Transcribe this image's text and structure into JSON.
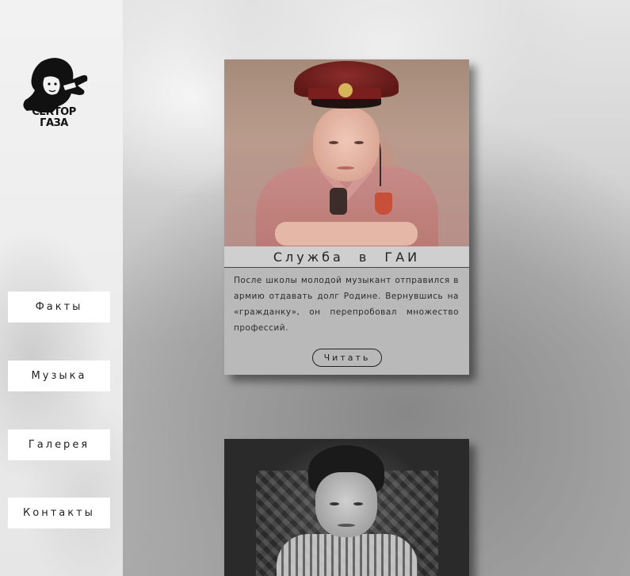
{
  "logo": {
    "text": "СЕКТОР ГАЗА",
    "icon": "band-logo-icon"
  },
  "nav": {
    "items": [
      {
        "label": "Факты"
      },
      {
        "label": "Музыка"
      },
      {
        "label": "Галерея"
      },
      {
        "label": "Контакты"
      }
    ]
  },
  "cards": [
    {
      "title": "Служба в ГАИ",
      "text": "После школы молодой музыкант отправился в армию отдавать долг Родине. Вернувшись на «гражданку», он перепробовал множество профессий.",
      "button_label": "Читать",
      "photo": "portrait-in-traffic-police-uniform"
    },
    {
      "photo": "childhood-portrait"
    }
  ],
  "colors": {
    "sidebar_bg": "#eeeeee",
    "nav_button_bg": "#ffffff",
    "card_bg": "#b9b9b9",
    "card_title_bg": "#cfcfcf",
    "text": "#222222"
  }
}
